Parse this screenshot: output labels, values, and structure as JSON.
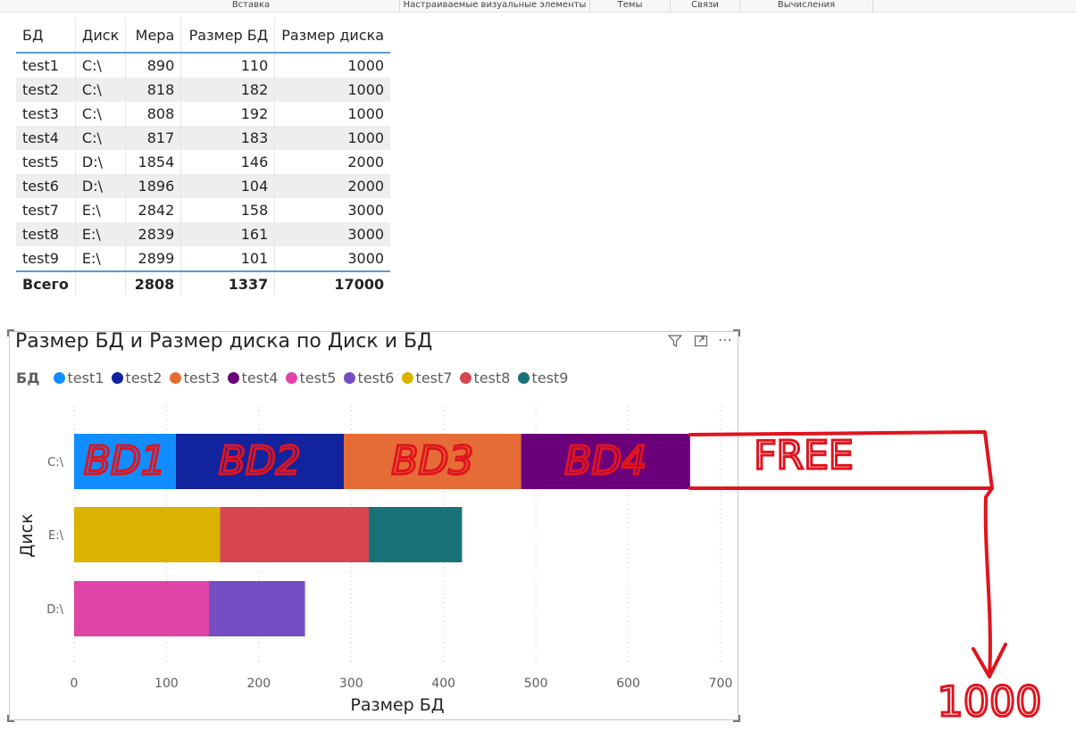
{
  "ribbon": {
    "groups": [
      "Вставка",
      "Настраиваемые визуальные элементы",
      "Темы",
      "Связи",
      "Вычисления"
    ]
  },
  "table": {
    "columns": [
      "БД",
      "Диск",
      "Мера",
      "Размер БД",
      "Размер диска"
    ],
    "rows": [
      [
        "test1",
        "C:\\",
        "890",
        "110",
        "1000"
      ],
      [
        "test2",
        "C:\\",
        "818",
        "182",
        "1000"
      ],
      [
        "test3",
        "C:\\",
        "808",
        "192",
        "1000"
      ],
      [
        "test4",
        "C:\\",
        "817",
        "183",
        "1000"
      ],
      [
        "test5",
        "D:\\",
        "1854",
        "146",
        "2000"
      ],
      [
        "test6",
        "D:\\",
        "1896",
        "104",
        "2000"
      ],
      [
        "test7",
        "E:\\",
        "2842",
        "158",
        "3000"
      ],
      [
        "test8",
        "E:\\",
        "2839",
        "161",
        "3000"
      ],
      [
        "test9",
        "E:\\",
        "2899",
        "101",
        "3000"
      ]
    ],
    "total": [
      "Всего",
      "",
      "2808",
      "1337",
      "17000"
    ]
  },
  "visual": {
    "icons": [
      "filter-icon",
      "focus-mode-icon",
      "more-options-icon"
    ]
  },
  "chart_data": {
    "type": "bar",
    "orientation": "horizontal",
    "stacked": true,
    "title": "Размер БД и Размер диска по Диск и БД",
    "xlabel": "Размер БД",
    "ylabel": "Диск",
    "legend_title": "БД",
    "legend_position": "top-left",
    "categories": [
      "C:\\",
      "E:\\",
      "D:\\"
    ],
    "xlim": [
      0,
      700
    ],
    "xticks": [
      0,
      100,
      200,
      300,
      400,
      500,
      600,
      700
    ],
    "grid": true,
    "series": [
      {
        "name": "test1",
        "color": "#118dff",
        "values": [
          110,
          0,
          0
        ]
      },
      {
        "name": "test2",
        "color": "#12239e",
        "values": [
          182,
          0,
          0
        ]
      },
      {
        "name": "test3",
        "color": "#e66c37",
        "values": [
          192,
          0,
          0
        ]
      },
      {
        "name": "test4",
        "color": "#6b007b",
        "values": [
          183,
          0,
          0
        ]
      },
      {
        "name": "test5",
        "color": "#e044a7",
        "values": [
          0,
          0,
          146
        ]
      },
      {
        "name": "test6",
        "color": "#744ec2",
        "values": [
          0,
          0,
          104
        ]
      },
      {
        "name": "test7",
        "color": "#d9b300",
        "values": [
          0,
          158,
          0
        ]
      },
      {
        "name": "test8",
        "color": "#d64550",
        "values": [
          0,
          161,
          0
        ]
      },
      {
        "name": "test9",
        "color": "#197278",
        "values": [
          0,
          101,
          0
        ]
      }
    ]
  },
  "annotations": {
    "color": "#e0141e",
    "segment_labels": [
      "BD1",
      "BD2",
      "BD3",
      "BD4"
    ],
    "free_label": "FREE",
    "disk_size_label": "1000"
  }
}
